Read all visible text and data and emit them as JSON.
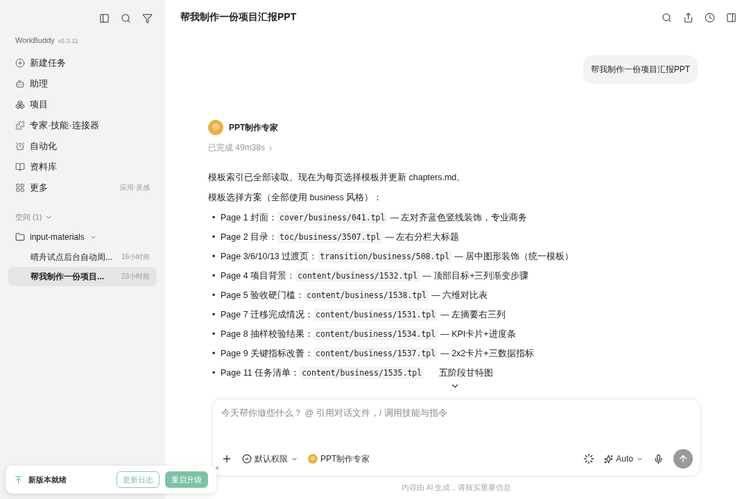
{
  "sidebar": {
    "brand": "WorkBuddy",
    "version": "v5.3.11",
    "nav": [
      {
        "label": "新建任务"
      },
      {
        "label": "助理"
      },
      {
        "label": "项目"
      },
      {
        "label": "专家·技能·连接器"
      },
      {
        "label": "自动化"
      },
      {
        "label": "资料库"
      },
      {
        "label": "更多",
        "hint": "应用·灵感"
      }
    ],
    "space": {
      "label": "空间 (1)"
    },
    "folder": {
      "label": "input-materials",
      "expanded": true,
      "children": [
        {
          "title": "晴舟试点后台自动周...",
          "time": "16小时前",
          "selected": false
        },
        {
          "title": "帮我制作一份项目...",
          "time": "23小时前",
          "selected": true
        }
      ]
    }
  },
  "toast": {
    "label": "新版本就绪",
    "close": "×",
    "buttons": [
      {
        "label": "更新日志",
        "kind": "outline"
      },
      {
        "label": "重启升级",
        "kind": "filled"
      }
    ]
  },
  "header": {
    "title": "帮我制作一份项目汇报PPT"
  },
  "chat": {
    "user_message": "帮我制作一份项目汇报PPT",
    "agent": {
      "name": "PPT制作专家",
      "status": "已完成 49m38s"
    },
    "paragraphs": [
      "模板索引已全部读取。现在为每页选择模板并更新 chapters.md。",
      "模板选择方案（全部使用 business 风格）："
    ],
    "items": [
      {
        "bullet": "•",
        "page": "Page 1 封面：",
        "code": "cover/business/041.tpl",
        "desc": "— 左对齐蓝色竖线装饰，专业商务"
      },
      {
        "bullet": "•",
        "page": "Page 2 目录：",
        "code": "toc/business/3507.tpl",
        "desc": "— 左右分栏大标题"
      },
      {
        "bullet": "•",
        "page": "Page 3/6/10/13 过渡页：",
        "code": "transition/business/508.tpl",
        "desc": "— 居中图形装饰（统一模板）"
      },
      {
        "bullet": "•",
        "page": "Page 4 项目背景：",
        "code": "content/business/1532.tpl",
        "desc": "— 顶部目标+三列渐变步骤"
      },
      {
        "bullet": "•",
        "page": "Page 5 验收硬门槛：",
        "code": "content/business/1538.tpl",
        "desc": "— 六维对比表"
      },
      {
        "bullet": "•",
        "page": "Page 7 迁移完成情况：",
        "code": "content/business/1531.tpl",
        "desc": "— 左摘要右三列"
      },
      {
        "bullet": "•",
        "page": "Page 8 抽样校验结果：",
        "code": "content/business/1534.tpl",
        "desc": "— KPI卡片+进度条"
      },
      {
        "bullet": "•",
        "page": "Page 9 关键指标改善：",
        "code": "content/business/1537.tpl",
        "desc": "— 2x2卡片+三数据指标"
      },
      {
        "bullet": "•",
        "page": "Page 11 任务清单：",
        "code": "content/business/1535.tpl",
        "desc": "五阶段甘特图"
      }
    ]
  },
  "composer": {
    "placeholder": "今天帮你做些什么？ @ 引用对话文件，/ 调用技能与指令",
    "permission": "默认权限",
    "agent": "PPT制作专家",
    "model": "Auto"
  },
  "footer_note": "内容由 AI 生成，请核实重要信息"
}
